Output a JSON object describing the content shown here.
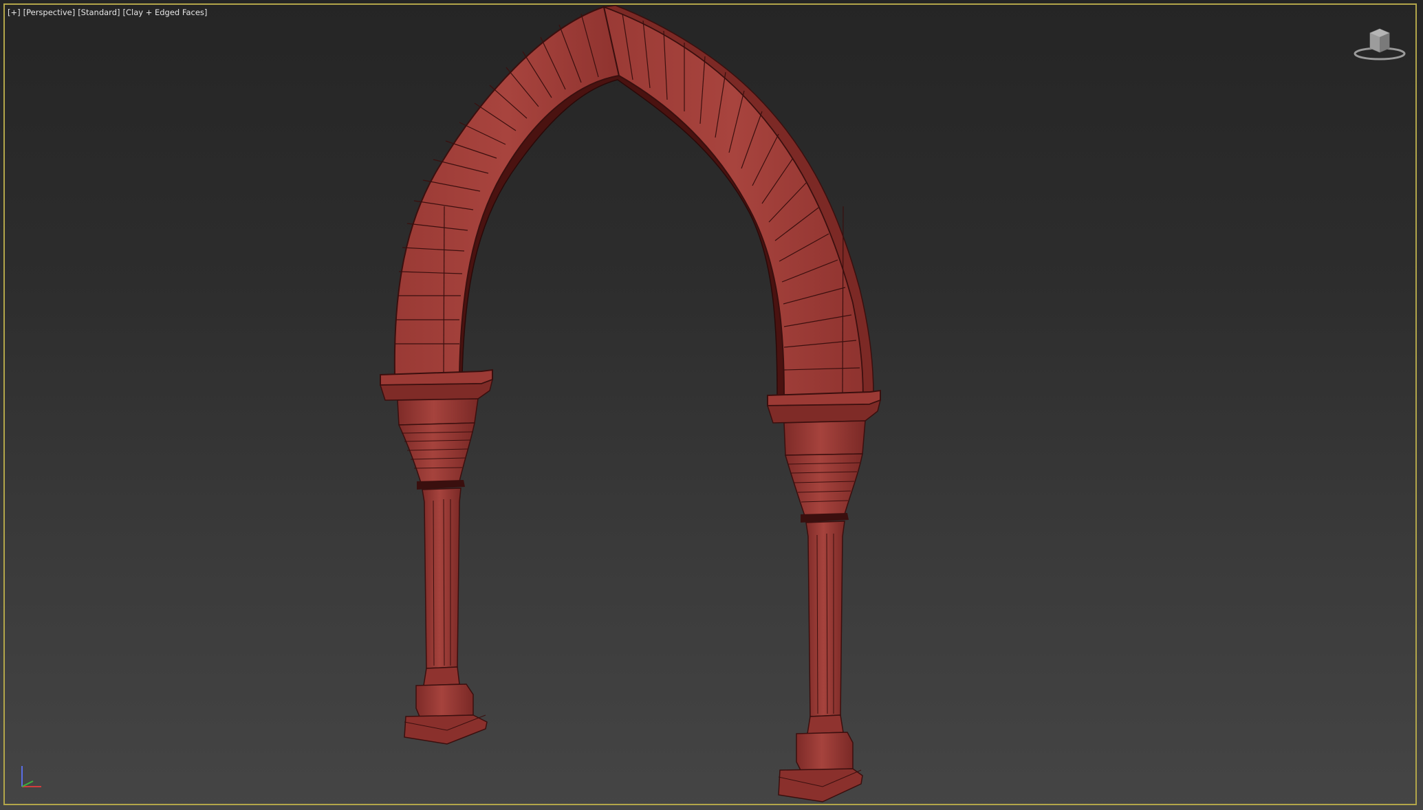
{
  "viewport": {
    "label_plus": "[+]",
    "label_view": "[Perspective]",
    "label_shading_style": "[Standard]",
    "label_display_mode": "[Clay + Edged Faces]"
  },
  "colors": {
    "border_active": "#b3a64a",
    "clay_light": "#a8443e",
    "clay_mid": "#8a302c",
    "clay_dark": "#5a1816",
    "clay_edge": "#3a0f0e",
    "axis_x": "#d23c3c",
    "axis_y": "#3cb43c",
    "axis_z": "#5a6ee6"
  },
  "icons": {
    "viewcube": "viewcube-icon",
    "axis_tripod": "axis-tripod-icon"
  }
}
